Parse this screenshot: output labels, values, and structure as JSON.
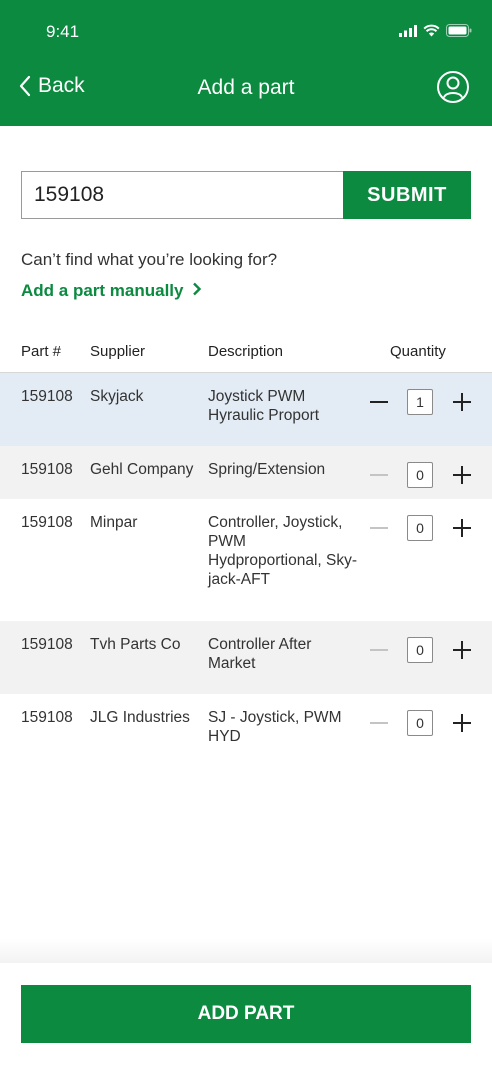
{
  "status": {
    "time": "9:41"
  },
  "nav": {
    "back_label": "Back",
    "title": "Add a part"
  },
  "search": {
    "value": "159108",
    "submit_label": "SUBMIT"
  },
  "help": {
    "text": "Can’t find what you’re looking for?",
    "link_label": "Add a part manually"
  },
  "table": {
    "headers": {
      "part": "Part #",
      "supplier": "Supplier",
      "description": "Description",
      "quantity": "Quantity"
    },
    "rows": [
      {
        "part": "159108",
        "supplier": "Skyjack",
        "description": "Joystick PWM Hyraulic Proport",
        "quantity": "1",
        "highlight": "#e3ebf5"
      },
      {
        "part": "159108",
        "supplier": "Gehl Company",
        "description": "Spring/Extension",
        "quantity": "0",
        "highlight": "#f2f2f2"
      },
      {
        "part": "159108",
        "supplier": "Minpar",
        "description": "Controller, Joystick, PWM Hydproportional, Sky-jack-AFT",
        "quantity": "0",
        "highlight": "#ffffff"
      },
      {
        "part": "159108",
        "supplier": "Tvh Parts Co",
        "description": "Controller After Market",
        "quantity": "0",
        "highlight": "#f2f2f2"
      },
      {
        "part": "159108",
        "supplier": "JLG Industries",
        "description": "SJ - Joystick, PWM HYD",
        "quantity": "0",
        "highlight": "#ffffff"
      }
    ]
  },
  "footer": {
    "add_label": "ADD PART"
  },
  "colors": {
    "brand": "#0b8a40",
    "selected_row": "#e3ebf5",
    "alt_row": "#f2f2f2"
  },
  "icons": [
    "signal-icon",
    "wifi-icon",
    "battery-icon",
    "chevron-left-icon",
    "user-icon",
    "chevron-right-icon"
  ]
}
